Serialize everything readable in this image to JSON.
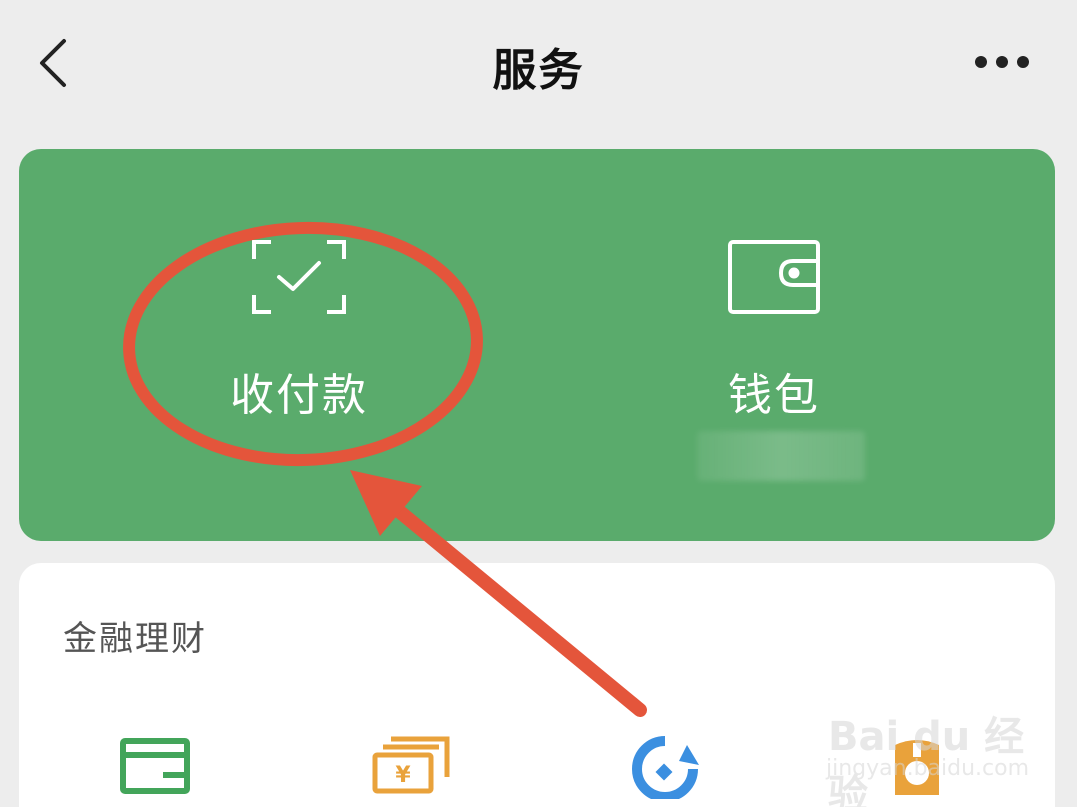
{
  "header": {
    "title": "服务",
    "back_icon": "chevron-left-icon",
    "more_icon": "more-horizontal-icon"
  },
  "primary_card": {
    "background": "#5aab6c",
    "items": [
      {
        "label": "收付款",
        "icon": "scan-check-icon"
      },
      {
        "label": "钱包",
        "icon": "wallet-icon"
      }
    ]
  },
  "finance_section": {
    "title": "金融理财",
    "icons": [
      "credit-card-icon",
      "yuan-bill-icon",
      "fund-icon",
      "piggy-bank-icon"
    ]
  },
  "annotation": {
    "color": "#e4553b",
    "shape": "ellipse-with-arrow"
  },
  "watermark": {
    "brand": "Bai du 经验",
    "url": "jingyan.baidu.com"
  }
}
